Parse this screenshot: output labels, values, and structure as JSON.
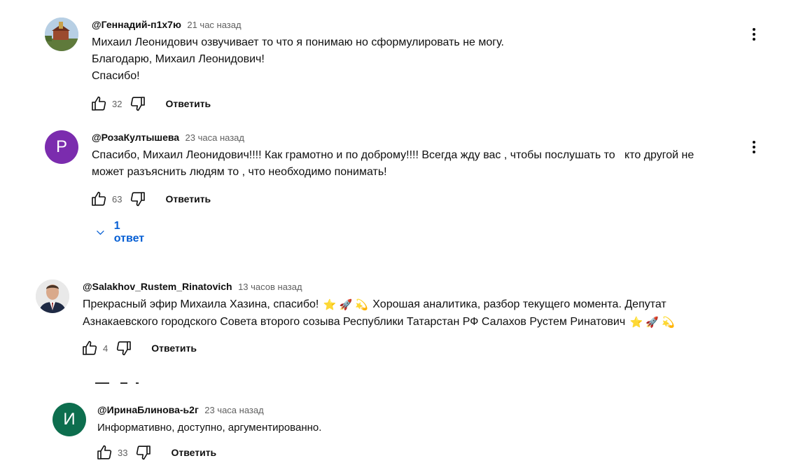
{
  "comments": [
    {
      "author": "@Геннадий-п1х7ю",
      "time": "21 час назад",
      "lines": [
        "Михаил Леонидович озвучивает то что я понимаю но сформулировать не могу.",
        "Благодарю, Михаил Леонидович!",
        "Спасибо!"
      ],
      "likes": "32",
      "reply_label": "Ответить",
      "avatar": "photo"
    },
    {
      "author": "@РозаКултышева",
      "time": "23 часа назад",
      "lines": [
        "Спасибо, Михаил Леонидович!!!! Как грамотно и по доброму!!!! Всегда жду вас , чтобы послушать то   кто другой не",
        "может разъяснить людям то , что необходимо понимать!"
      ],
      "likes": "63",
      "reply_label": "Ответить",
      "avatar_letter": "P",
      "avatar_color": "#7b2cae",
      "replies_toggle": "1 ответ"
    },
    {
      "author": "@Salakhov_Rustem_Rinatovich",
      "time": "13 часов назад",
      "line1_a": "Прекрасный эфир Михаила Хазина, спасибо!",
      "line1_b": "Хорошая аналитика, разбор текущего момента. Депутат",
      "line2": "Азнакаевского городского Совета второго созыва Республики Татарстан РФ Салахов Рустем Ринатович",
      "emojis": [
        "⭐",
        "🚀",
        "💫"
      ],
      "likes": "4",
      "reply_label": "Ответить",
      "avatar": "photo"
    },
    {
      "author": "@ИринаБлинова-ь2г",
      "time": "23 часа назад",
      "lines": [
        "Информативно, доступно, аргументированно."
      ],
      "likes": "33",
      "reply_label": "Ответить",
      "avatar_letter": "И",
      "avatar_color": "#0d6e4e"
    }
  ],
  "colors": {
    "link": "#065fd4",
    "secondary": "#606060",
    "text": "#0f0f0f"
  },
  "icons": [
    "like-icon",
    "dislike-icon",
    "more-icon",
    "chevron-down-icon"
  ]
}
